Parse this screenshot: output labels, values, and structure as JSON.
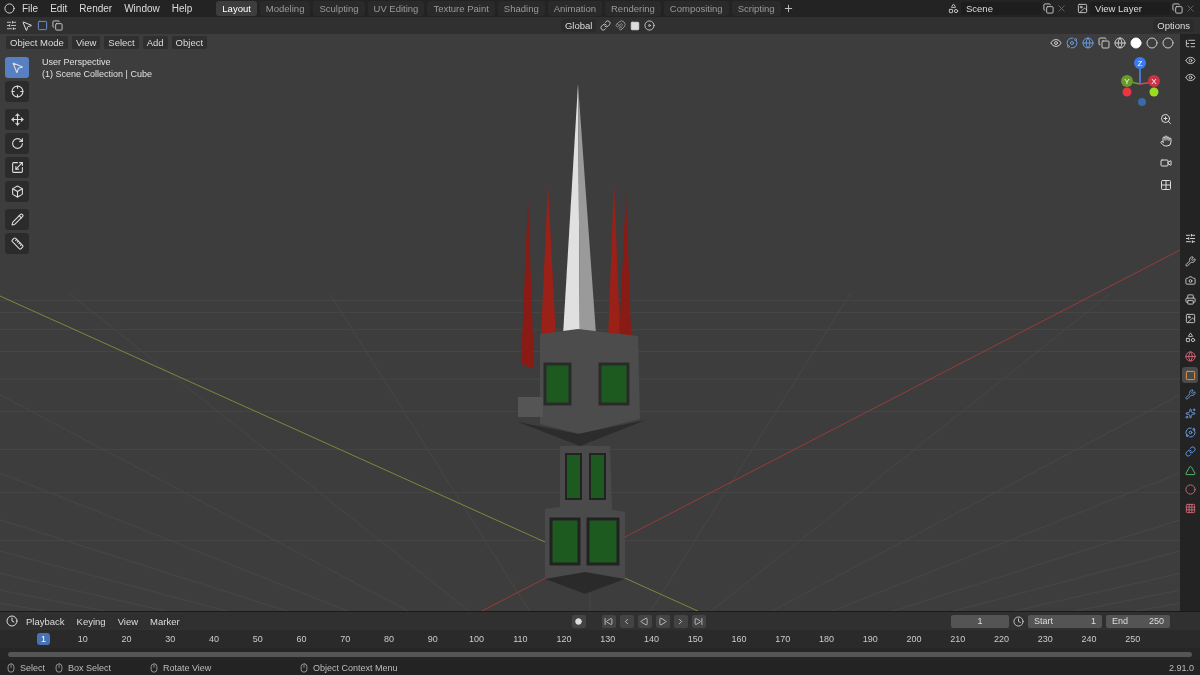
{
  "menus": [
    "File",
    "Edit",
    "Render",
    "Window",
    "Help"
  ],
  "workspaces": [
    {
      "label": "Layout",
      "selected": true
    },
    {
      "label": "Modeling",
      "selected": false
    },
    {
      "label": "Sculpting",
      "selected": false
    },
    {
      "label": "UV Editing",
      "selected": false
    },
    {
      "label": "Texture Paint",
      "selected": false
    },
    {
      "label": "Shading",
      "selected": false
    },
    {
      "label": "Animation",
      "selected": false
    },
    {
      "label": "Rendering",
      "selected": false
    },
    {
      "label": "Compositing",
      "selected": false
    },
    {
      "label": "Scripting",
      "selected": false
    }
  ],
  "scene": "Scene",
  "view_layer": "View Layer",
  "tool_header": {
    "orientation": "Global",
    "options": "Options"
  },
  "viewport_header": {
    "mode": "Object Mode",
    "menus": [
      "View",
      "Select",
      "Add",
      "Object"
    ]
  },
  "viewport": {
    "perspective": "User Perspective",
    "collection": "(1) Scene Collection | Cube",
    "gizmo": {
      "x": "X",
      "y": "Y",
      "z": "Z"
    }
  },
  "tools": [
    {
      "kind": "select",
      "selected": true
    },
    {
      "kind": "cursor",
      "selected": false
    },
    {
      "kind": "move",
      "selected": false
    },
    {
      "kind": "rotate",
      "selected": false
    },
    {
      "kind": "scale",
      "selected": false
    },
    {
      "kind": "transform",
      "selected": false
    },
    {
      "kind": "annotate",
      "selected": false
    },
    {
      "kind": "measure",
      "selected": false
    }
  ],
  "property_tabs": [
    {
      "kind": "tool",
      "selected": false
    },
    {
      "kind": "render",
      "selected": false
    },
    {
      "kind": "output",
      "selected": false
    },
    {
      "kind": "view-layer",
      "selected": false
    },
    {
      "kind": "scene",
      "selected": false
    },
    {
      "kind": "world",
      "selected": false
    },
    {
      "kind": "object",
      "selected": true
    },
    {
      "kind": "modifiers",
      "selected": false
    },
    {
      "kind": "particles",
      "selected": false
    },
    {
      "kind": "physics",
      "selected": false
    },
    {
      "kind": "constraints",
      "selected": false
    },
    {
      "kind": "data",
      "selected": false
    },
    {
      "kind": "material",
      "selected": false
    },
    {
      "kind": "texture",
      "selected": false
    }
  ],
  "timeline": {
    "menus": [
      "Playback",
      "Keying",
      "View",
      "Marker"
    ],
    "current_frame": "1",
    "start_label": "Start",
    "start": "1",
    "end_label": "End",
    "end": "250",
    "playhead": "1",
    "ticks": [
      "10",
      "20",
      "30",
      "40",
      "50",
      "60",
      "70",
      "80",
      "90",
      "100",
      "110",
      "120",
      "130",
      "140",
      "150",
      "160",
      "170",
      "180",
      "190",
      "200",
      "210",
      "220",
      "230",
      "240",
      "250"
    ]
  },
  "status_bar": {
    "hints": [
      {
        "kind": "left",
        "label": "Select"
      },
      {
        "kind": "drag",
        "label": "Box Select"
      },
      {
        "kind": "middle",
        "label": "Rotate View"
      },
      {
        "kind": "right",
        "label": "Object Context Menu"
      }
    ],
    "version": "2.91.0"
  }
}
